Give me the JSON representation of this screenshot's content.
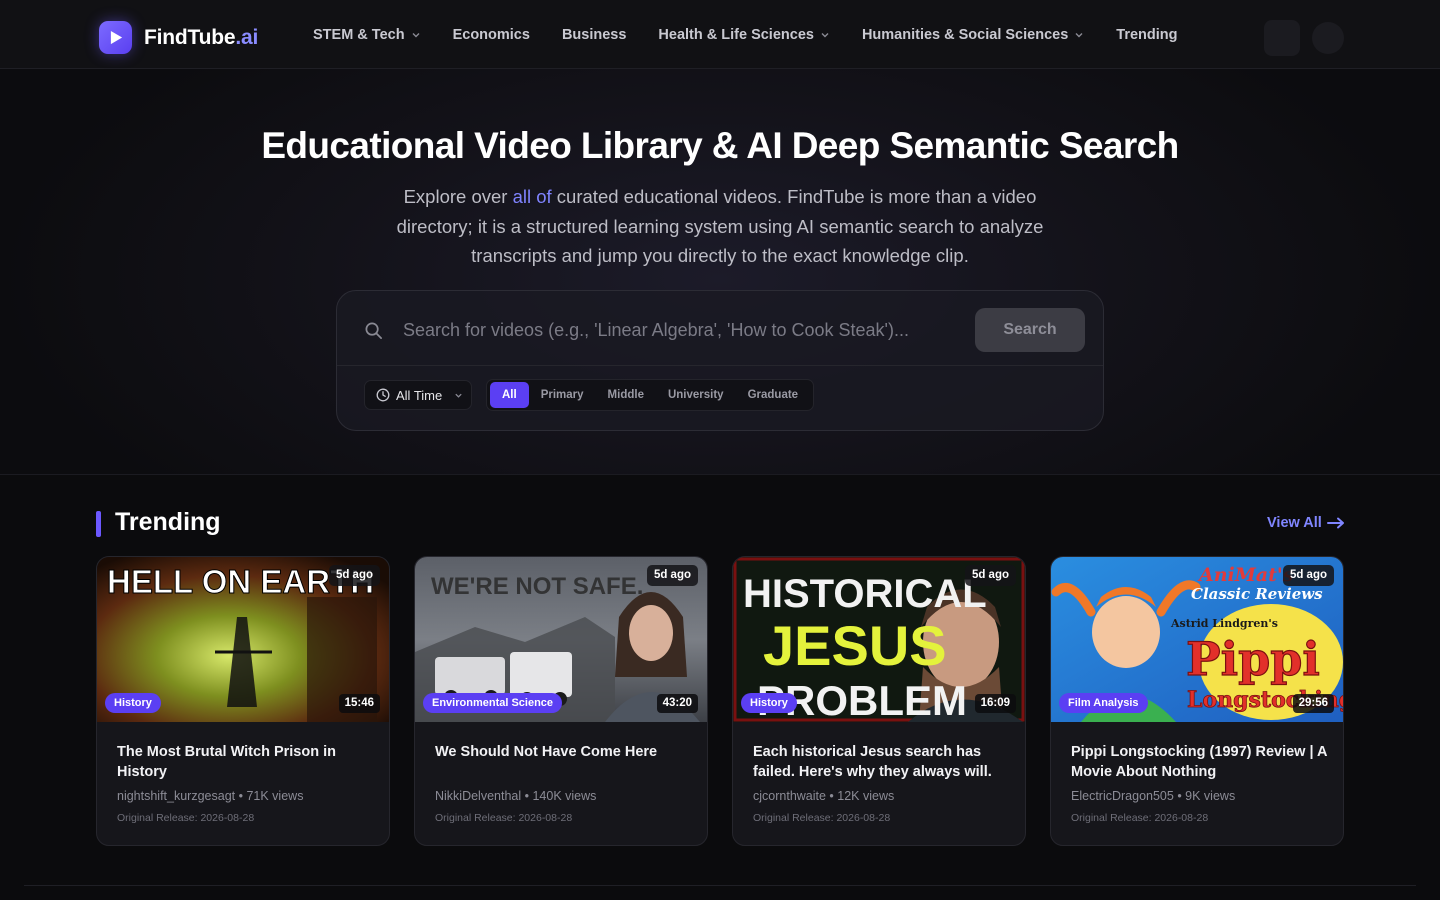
{
  "brand": {
    "name": "FindTube",
    "suffix": ".ai"
  },
  "nav": {
    "items": [
      {
        "label": "STEM & Tech",
        "dropdown": true
      },
      {
        "label": "Economics",
        "dropdown": false
      },
      {
        "label": "Business",
        "dropdown": false
      },
      {
        "label": "Health & Life Sciences",
        "dropdown": true
      },
      {
        "label": "Humanities & Social Sciences",
        "dropdown": true
      },
      {
        "label": "Trending",
        "dropdown": false
      }
    ]
  },
  "hero": {
    "title": "Educational Video Library & AI Deep Semantic Search",
    "subtitle_pre": "Explore over ",
    "subtitle_highlight": "all of",
    "subtitle_post": " curated educational videos. FindTube is more than a video directory; it is a structured learning system using AI semantic search to analyze transcripts and jump you directly to the exact knowledge clip."
  },
  "search": {
    "placeholder": "Search for videos (e.g., 'Linear Algebra', 'How to Cook Steak')...",
    "button_label": "Search",
    "time_filter": "All Time",
    "levels": [
      "All",
      "Primary",
      "Middle",
      "University",
      "Graduate"
    ],
    "active_level": "All"
  },
  "trending": {
    "title": "Trending",
    "view_all": "View All",
    "videos": [
      {
        "title": "The Most Brutal Witch Prison in History",
        "channel": "nightshift_kurzgesagt",
        "views": "71K views",
        "ago": "5d ago",
        "duration": "15:46",
        "category": "History",
        "release": "Original Release: 2026-08-28",
        "thumb_text": "HELL ON EARTH"
      },
      {
        "title": "We Should Not Have Come Here",
        "channel": "NikkiDelventhal",
        "views": "140K views",
        "ago": "5d ago",
        "duration": "43:20",
        "category": "Environmental Science",
        "release": "Original Release: 2026-08-28",
        "thumb_text": "WE'RE NOT SAFE."
      },
      {
        "title": "Each historical Jesus search has failed. Here's why they always will.",
        "channel": "cjcornthwaite",
        "views": "12K views",
        "ago": "5d ago",
        "duration": "16:09",
        "category": "History",
        "release": "Original Release: 2026-08-28",
        "thumb_text_1": "HISTORICAL",
        "thumb_text_2": "JESUS",
        "thumb_text_3": "PROBLEM"
      },
      {
        "title": "Pippi Longstocking (1997) Review | A Movie About Nothing",
        "channel": "ElectricDragon505",
        "views": "9K views",
        "ago": "5d ago",
        "duration": "29:56",
        "category": "Film Analysis",
        "release": "Original Release: 2026-08-28",
        "thumb_text_1": "AniMat's",
        "thumb_text_2": "Classic Reviews",
        "thumb_text_3": "Astrid Lindgren's",
        "thumb_text_4": "Pippi",
        "thumb_text_5": "Longstocking"
      }
    ]
  },
  "colors": {
    "accent": "#5b3ff3",
    "link": "#8086ff",
    "background": "#0b0b0d"
  }
}
